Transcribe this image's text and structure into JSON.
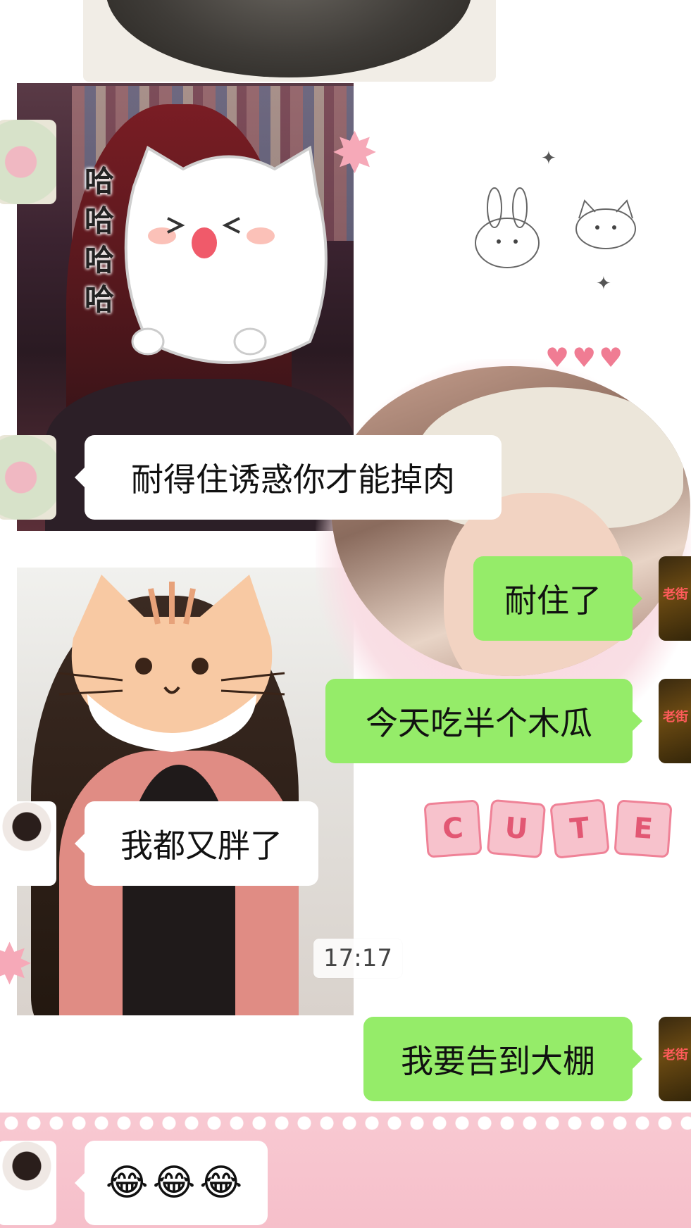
{
  "messages": [
    {
      "direction": "in",
      "avatar": "lotus",
      "text": "耐得住诱惑你才能掉肉"
    },
    {
      "direction": "out",
      "avatar": "self",
      "text": "耐住了"
    },
    {
      "direction": "out",
      "avatar": "self",
      "text": "今天吃半个木瓜"
    },
    {
      "direction": "in",
      "avatar": "portrait",
      "text": "我都又胖了"
    },
    {
      "direction": "out",
      "avatar": "self",
      "text": "我要告到大棚"
    },
    {
      "direction": "in",
      "avatar": "portrait",
      "text": "😂😂😂"
    }
  ],
  "timestamp": "17:17",
  "sticker": {
    "caption_chars": [
      "哈",
      "哈",
      "哈",
      "哈"
    ]
  },
  "decor": {
    "cute_letters": [
      "C",
      "U",
      "T",
      "E"
    ],
    "avatar_tag": "老街",
    "hearts": "♥♥♥"
  },
  "colors": {
    "outgoing_bubble": "#95ec69",
    "incoming_bubble": "#ffffff",
    "accent_pink": "#f6bfca"
  }
}
